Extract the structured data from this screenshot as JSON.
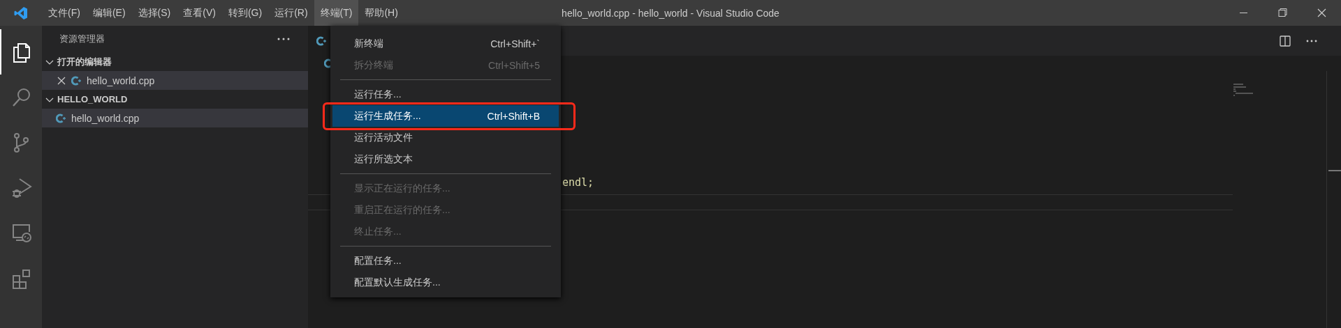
{
  "window": {
    "title": "hello_world.cpp - hello_world - Visual Studio Code"
  },
  "menubar": [
    {
      "label": "文件(F)",
      "selected": false
    },
    {
      "label": "编辑(E)",
      "selected": false
    },
    {
      "label": "选择(S)",
      "selected": false
    },
    {
      "label": "查看(V)",
      "selected": false
    },
    {
      "label": "转到(G)",
      "selected": false
    },
    {
      "label": "运行(R)",
      "selected": false
    },
    {
      "label": "终端(T)",
      "selected": true
    },
    {
      "label": "帮助(H)",
      "selected": false
    }
  ],
  "activity_bar": [
    {
      "kind": "explorer",
      "selected": true
    },
    {
      "kind": "search",
      "selected": false
    },
    {
      "kind": "source-control",
      "selected": false
    },
    {
      "kind": "run-debug",
      "selected": false
    },
    {
      "kind": "remote",
      "selected": false
    },
    {
      "kind": "extensions",
      "selected": false
    }
  ],
  "sidebar": {
    "title": "资源管理器",
    "sections": [
      {
        "kind": "open-editors",
        "title": "打开的编辑器",
        "expanded": true,
        "items": [
          {
            "name": "hello_world.cpp",
            "selected": true
          }
        ]
      },
      {
        "kind": "folder",
        "title": "HELLO_WORLD",
        "expanded": true,
        "items": [
          {
            "name": "hello_world.cpp",
            "selected": true
          }
        ]
      }
    ]
  },
  "editor": {
    "code_lines": [
      {
        "text": "endl;"
      }
    ]
  },
  "menu": {
    "items": [
      {
        "kind": "item",
        "label": "新终端",
        "shortcut": "Ctrl+Shift+`",
        "disabled": false,
        "selected": false,
        "circled": false
      },
      {
        "kind": "item",
        "label": "拆分终端",
        "shortcut": "Ctrl+Shift+5",
        "disabled": true,
        "selected": false,
        "circled": false
      },
      {
        "kind": "separator"
      },
      {
        "kind": "item",
        "label": "运行任务...",
        "disabled": false,
        "selected": false,
        "circled": false
      },
      {
        "kind": "item",
        "label": "运行生成任务...",
        "shortcut": "Ctrl+Shift+B",
        "disabled": false,
        "selected": true,
        "circled": true
      },
      {
        "kind": "item",
        "label": "运行活动文件",
        "disabled": false,
        "selected": false,
        "circled": false
      },
      {
        "kind": "item",
        "label": "运行所选文本",
        "disabled": false,
        "selected": false,
        "circled": false
      },
      {
        "kind": "separator"
      },
      {
        "kind": "item",
        "label": "显示正在运行的任务...",
        "disabled": true,
        "selected": false,
        "circled": false
      },
      {
        "kind": "item",
        "label": "重启正在运行的任务...",
        "disabled": true,
        "selected": false,
        "circled": false
      },
      {
        "kind": "item",
        "label": "终止任务...",
        "disabled": true,
        "selected": false,
        "circled": false
      },
      {
        "kind": "separator"
      },
      {
        "kind": "item",
        "label": "配置任务...",
        "disabled": false,
        "selected": false,
        "circled": false
      },
      {
        "kind": "item",
        "label": "配置默认生成任务...",
        "disabled": false,
        "selected": false,
        "circled": false
      }
    ]
  }
}
